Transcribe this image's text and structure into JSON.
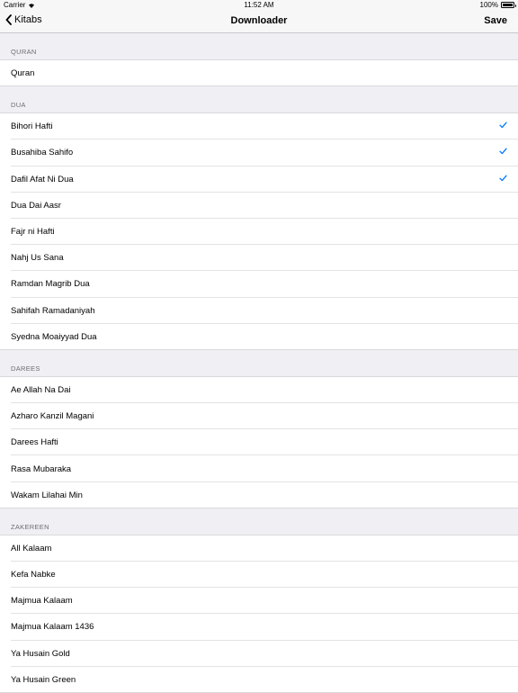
{
  "status_bar": {
    "carrier": "Carrier",
    "time": "11:52 AM",
    "battery": "100%"
  },
  "nav": {
    "back_label": "Kitabs",
    "title": "Downloader",
    "save_label": "Save"
  },
  "colors": {
    "accent": "#007aff",
    "background": "#efeff4"
  },
  "sections": [
    {
      "header": "QURAN",
      "items": [
        {
          "label": "Quran",
          "checked": false
        }
      ]
    },
    {
      "header": "DUA",
      "items": [
        {
          "label": "Bihori Hafti",
          "checked": true
        },
        {
          "label": "Busahiba Sahifo",
          "checked": true
        },
        {
          "label": "Dafil Afat Ni Dua",
          "checked": true
        },
        {
          "label": "Dua Dai Aasr",
          "checked": false
        },
        {
          "label": "Fajr ni Hafti",
          "checked": false
        },
        {
          "label": "Nahj Us Sana",
          "checked": false
        },
        {
          "label": "Ramdan Magrib Dua",
          "checked": false
        },
        {
          "label": "Sahifah Ramadaniyah",
          "checked": false
        },
        {
          "label": "Syedna Moaiyyad Dua",
          "checked": false
        }
      ]
    },
    {
      "header": "DAREES",
      "items": [
        {
          "label": "Ae Allah Na Dai",
          "checked": false
        },
        {
          "label": "Azharo Kanzil Magani",
          "checked": false
        },
        {
          "label": "Darees Hafti",
          "checked": false
        },
        {
          "label": "Rasa Mubaraka",
          "checked": false
        },
        {
          "label": "Wakam Lilahai Min",
          "checked": false
        }
      ]
    },
    {
      "header": "ZAKEREEN",
      "items": [
        {
          "label": "All Kalaam",
          "checked": false
        },
        {
          "label": "Kefa Nabke",
          "checked": false
        },
        {
          "label": "Majmua Kalaam",
          "checked": false
        },
        {
          "label": "Majmua Kalaam 1436",
          "checked": false
        },
        {
          "label": "Ya Husain Gold",
          "checked": false
        },
        {
          "label": "Ya Husain Green",
          "checked": false
        }
      ]
    }
  ]
}
